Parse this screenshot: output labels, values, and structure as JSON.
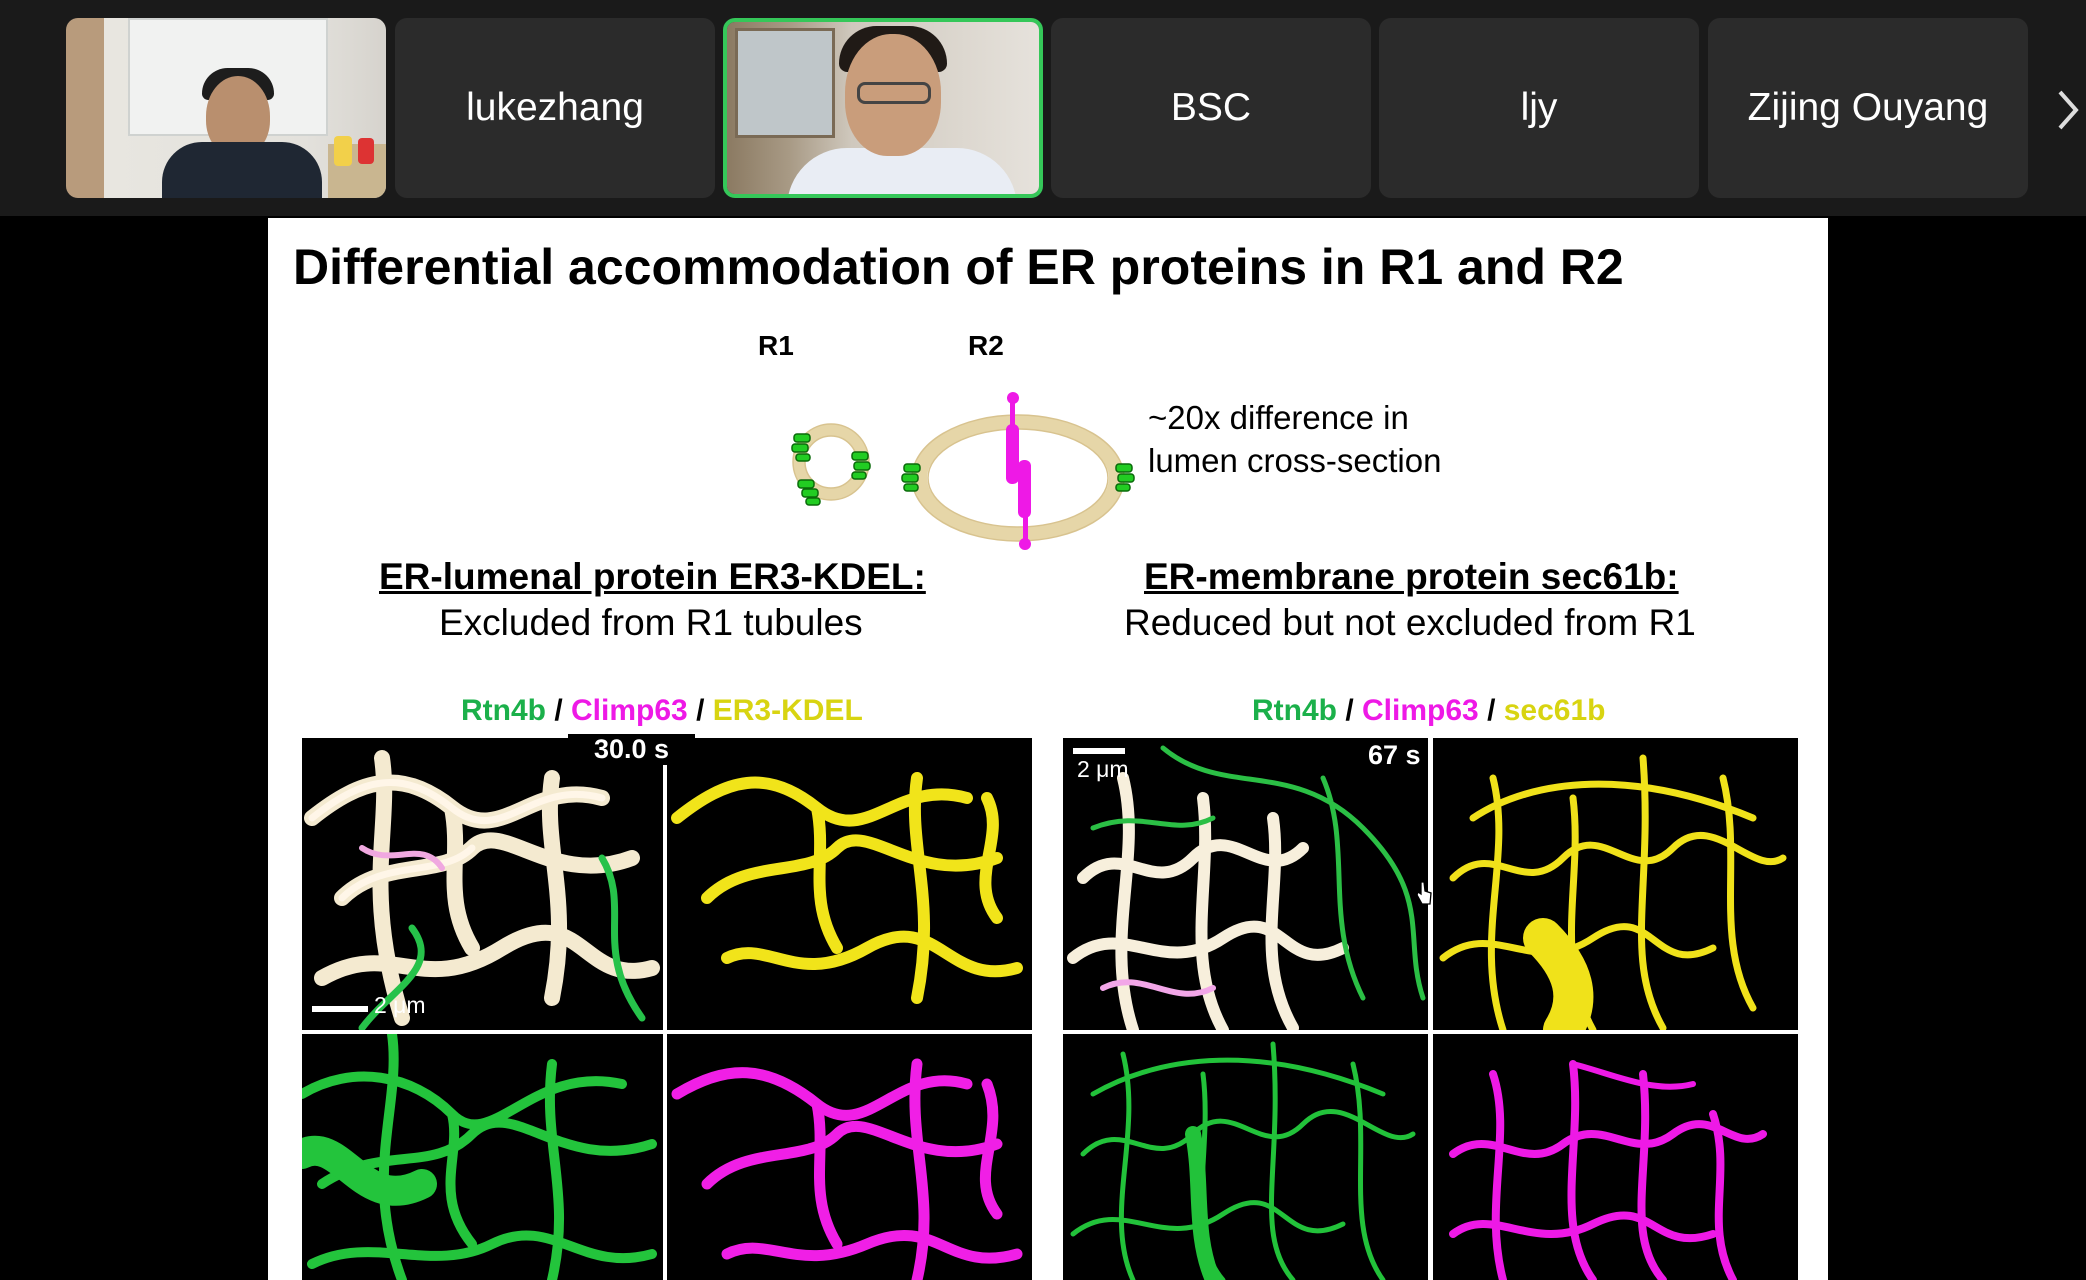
{
  "participants": [
    {
      "id": "video-1",
      "name": "",
      "type": "video"
    },
    {
      "id": "lukezhang",
      "name": "lukezhang",
      "type": "name"
    },
    {
      "id": "video-2",
      "name": "",
      "type": "video",
      "active": true
    },
    {
      "id": "bsc",
      "name": "BSC",
      "type": "name"
    },
    {
      "id": "ljy",
      "name": "ljy",
      "type": "name"
    },
    {
      "id": "zijing",
      "name": "Zijing Ouyang",
      "type": "name"
    }
  ],
  "strip_next_icon": "chevron-right-icon",
  "slide": {
    "title": "Differential accommodation of ER proteins in R1 and R2",
    "r1_label": "R1",
    "r2_label": "R2",
    "difference_line1": "~20x difference in",
    "difference_line2": "lumen cross-section",
    "left_heading": "ER-lumenal protein ER3-KDEL:",
    "left_subheading": "Excluded from R1 tubules",
    "right_heading": "ER-membrane protein sec61b:",
    "right_subheading": "Reduced but not excluded from R1",
    "left_legend": {
      "a": "Rtn4b",
      "sep1": " / ",
      "b": "Climp63",
      "sep2": " / ",
      "c": "ER3-KDEL"
    },
    "right_legend": {
      "a": "Rtn4b",
      "sep1": " / ",
      "b": "Climp63",
      "sep2": " / ",
      "c": "sec61b"
    },
    "left_time": "30.0 s",
    "left_scale": "2 μm",
    "right_time": "67 s",
    "right_scale": "2 μm"
  },
  "colors": {
    "active_border": "#35c759",
    "green": "#1bb04a",
    "magenta": "#ee19e6",
    "yellow": "#d8d411",
    "tube": "#efe0b0"
  }
}
